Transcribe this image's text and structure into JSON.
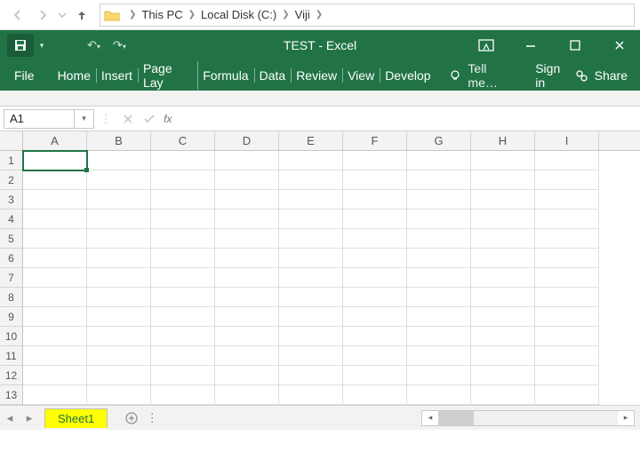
{
  "explorer": {
    "crumbs": [
      "This PC",
      "Local Disk (C:)",
      "Viji"
    ]
  },
  "title": "TEST - Excel",
  "ribbon": {
    "file": "File",
    "tabs": [
      "Home",
      "Insert",
      "Page Lay",
      "Formula",
      "Data",
      "Review",
      "View",
      "Develop"
    ],
    "tellme": "Tell me…",
    "signin": "Sign in",
    "share": "Share"
  },
  "namebox": "A1",
  "fx": "fx",
  "columns": [
    "A",
    "B",
    "C",
    "D",
    "E",
    "F",
    "G",
    "H",
    "I"
  ],
  "rows": [
    "1",
    "2",
    "3",
    "4",
    "5",
    "6",
    "7",
    "8",
    "9",
    "10",
    "11",
    "12",
    "13"
  ],
  "sheet": {
    "active": "Sheet1"
  }
}
